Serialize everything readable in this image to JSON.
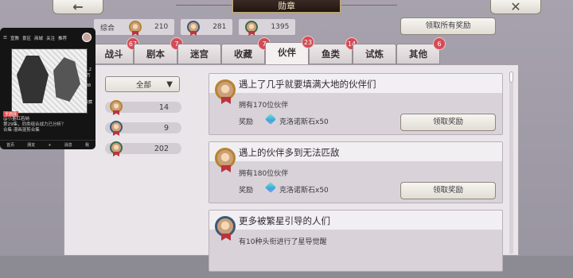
{
  "header": {
    "back_icon": "←",
    "title": "勋章",
    "close_icon": "✕"
  },
  "stats": {
    "all_label": "综合",
    "gold_count": "210",
    "silver_count": "281",
    "bronze_count": "1395"
  },
  "claim_all_label": "领取所有奖励",
  "tabs": [
    {
      "label": "战斗",
      "badge": "67"
    },
    {
      "label": "剧本",
      "badge": "7"
    },
    {
      "label": "迷宫",
      "badge": ""
    },
    {
      "label": "收藏",
      "badge": "7"
    },
    {
      "label": "伙伴",
      "badge": "23"
    },
    {
      "label": "鱼类",
      "badge": "14"
    },
    {
      "label": "试炼",
      "badge": ""
    },
    {
      "label": "其他",
      "badge": "6"
    }
  ],
  "active_tab": "伙伴",
  "filter": {
    "selected": "全部",
    "tiers": [
      {
        "medal": "gold",
        "count": "14"
      },
      {
        "medal": "blue",
        "count": "9"
      },
      {
        "medal": "green",
        "count": "202"
      }
    ]
  },
  "achievements": [
    {
      "title": "遇上了几乎就要填满大地的伙伴们",
      "desc": "拥有170位伙伴",
      "reward_label": "奖励",
      "reward": "克洛诺斯石x50",
      "claim_label": "领取奖励"
    },
    {
      "title": "遇上的伙伴多到无法匹敌",
      "desc": "拥有180位伙伴",
      "reward_label": "奖励",
      "reward": "克洛诺斯石x50",
      "claim_label": "领取奖励"
    },
    {
      "title": "更多被繁星引导的人们",
      "desc": "有10种头衔进行了星导觉醒"
    }
  ],
  "overlay": {
    "top_tabs": [
      "宣教",
      "景区",
      "商城",
      "关注",
      "推荐"
    ],
    "tag": "全面展",
    "line1": "@小董红若纳",
    "line2": "第29集，同类组合战力已分析？",
    "line3": "合集·漫画混剪合集",
    "bottom_tabs": [
      "首页",
      "朋友",
      "+",
      "消息",
      "我"
    ],
    "side_counts": [
      "1.2万",
      "88",
      "收藏",
      "分享"
    ]
  }
}
